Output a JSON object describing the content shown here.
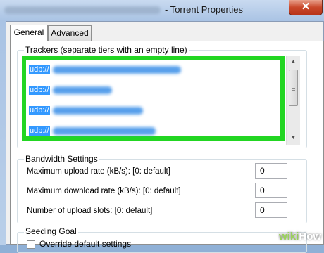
{
  "window": {
    "title": "- Torrent Properties",
    "close_glyph": "✕"
  },
  "tabs": [
    {
      "label": "General",
      "active": true
    },
    {
      "label": "Advanced",
      "active": false
    }
  ],
  "trackers": {
    "label": "Trackers (separate tiers with an empty line)",
    "items": [
      {
        "prefix": "udp://"
      },
      {
        "prefix": "udp://"
      },
      {
        "prefix": "udp://"
      },
      {
        "prefix": "udp://"
      }
    ],
    "highlight_color": "#22d622",
    "selection_color": "#3399ff"
  },
  "bandwidth": {
    "label": "Bandwidth Settings",
    "rows": [
      {
        "label": "Maximum upload rate (kB/s): [0: default]",
        "value": "0"
      },
      {
        "label": "Maximum download rate (kB/s): [0: default]",
        "value": "0"
      },
      {
        "label": "Number of upload slots: [0: default]",
        "value": "0"
      }
    ]
  },
  "seeding": {
    "label": "Seeding Goal",
    "checkbox_label": "Override default settings"
  },
  "watermark": {
    "wiki": "wiki",
    "how": "How"
  },
  "icons": {
    "scroll_up": "arrow-up-icon",
    "scroll_down": "arrow-down-icon",
    "close": "close-icon"
  }
}
